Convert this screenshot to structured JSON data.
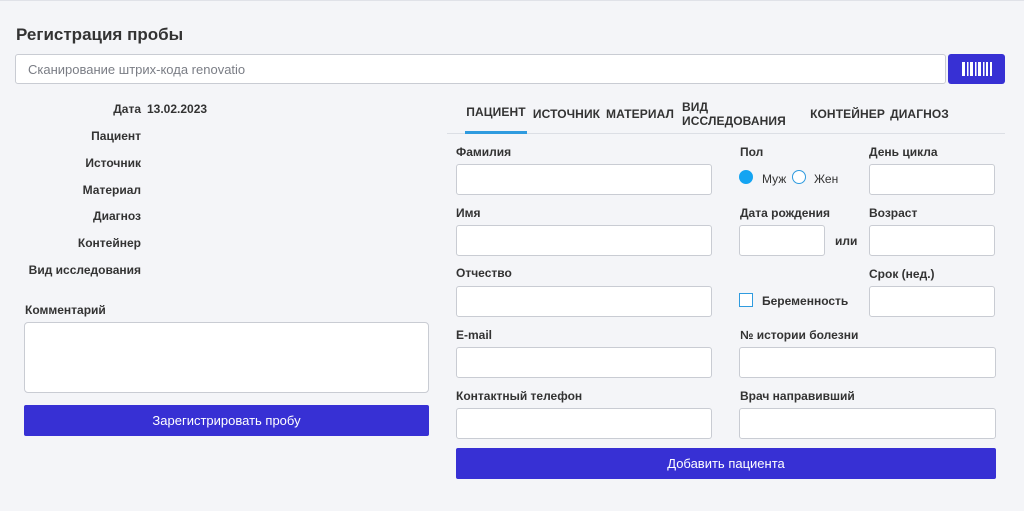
{
  "title": "Регистрация пробы",
  "scan": {
    "placeholder": "Сканирование штрих-кода renovatio",
    "button_icon": "barcode-icon"
  },
  "summary": {
    "date_label": "Дата",
    "date_value": "13.02.2023",
    "patient_label": "Пациент",
    "source_label": "Источник",
    "material_label": "Материал",
    "diagnosis_label": "Диагноз",
    "container_label": "Контейнер",
    "study_type_label": "Вид исследования"
  },
  "comment": {
    "label": "Комментарий",
    "value": ""
  },
  "register_button": "Зарегистрировать пробу",
  "tabs": [
    {
      "label": "ПАЦИЕНТ",
      "active": true
    },
    {
      "label": "ИСТОЧНИК",
      "active": false
    },
    {
      "label": "МАТЕРИАЛ",
      "active": false
    },
    {
      "label": "ВИД ИССЛЕДОВАНИЯ",
      "active": false
    },
    {
      "label": "КОНТЕЙНЕР",
      "active": false
    },
    {
      "label": "ДИАГНОЗ",
      "active": false
    }
  ],
  "form": {
    "last_name_label": "Фамилия",
    "first_name_label": "Имя",
    "middle_name_label": "Отчество",
    "email_label": "E-mail",
    "phone_label": "Контактный телефон",
    "sex_label": "Пол",
    "sex_male": "Муж",
    "sex_female": "Жен",
    "sex_selected": "Муж",
    "cycle_day_label": "День цикла",
    "birth_date_label": "Дата рождения",
    "or_label": "или",
    "age_label": "Возраст",
    "term_label": "Срок (нед.)",
    "pregnancy_label": "Беременность",
    "pregnancy_checked": false,
    "history_label": "№ истории болезни",
    "doctor_label": "Врач направивший"
  },
  "add_patient_button": "Добавить пациента",
  "colors": {
    "primary": "#3730d4",
    "accent": "#14a4f2",
    "tab_underline": "#2f9bdf",
    "background": "#f4f5f8"
  }
}
